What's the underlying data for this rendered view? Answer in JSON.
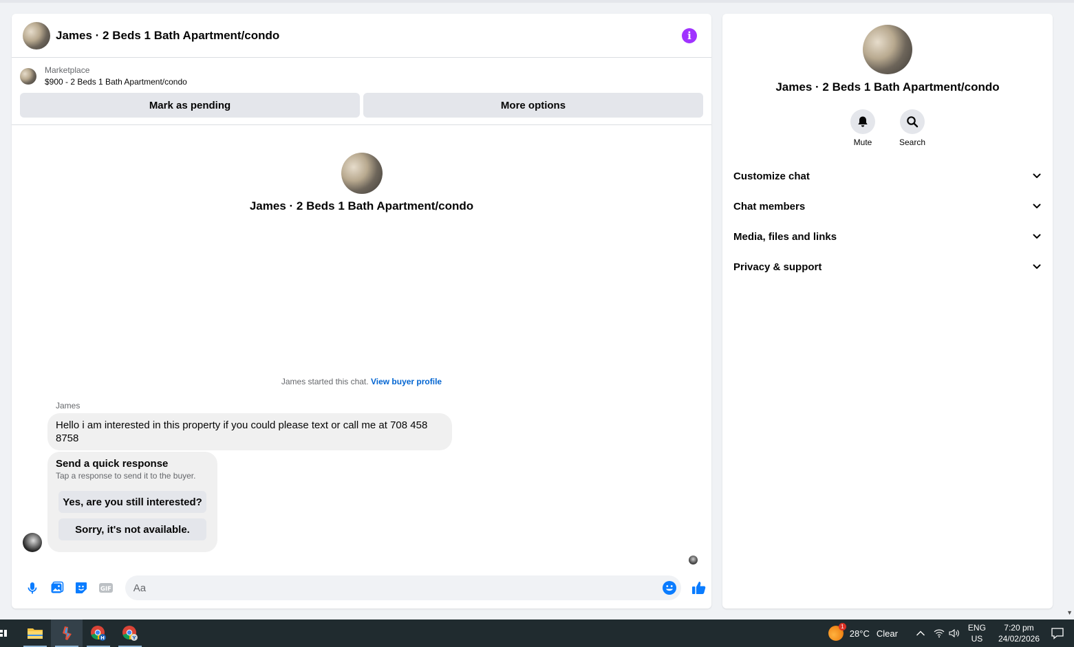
{
  "chat": {
    "title": "James · 2 Beds 1 Bath Apartment/condo",
    "listing": {
      "source": "Marketplace",
      "price_title": "$900 - 2 Beds 1 Bath Apartment/condo",
      "mark_pending": "Mark as pending",
      "more_options": "More options"
    },
    "intro_name": "James · 2 Beds 1 Bath Apartment/condo",
    "started_text": "James started this chat.",
    "view_profile": "View buyer profile",
    "sender": "James",
    "message": "Hello i am interested in this property if you could please text or call me at 708 458 8758",
    "quick": {
      "title": "Send a quick response",
      "subtitle": "Tap a response to send it to the buyer.",
      "option1": "Yes, are you still interested?",
      "option2": "Sorry, it's not available."
    },
    "composer_placeholder": "Aa"
  },
  "info": {
    "name": "James · 2 Beds 1 Bath Apartment/condo",
    "mute": "Mute",
    "search": "Search",
    "sections": [
      "Customize chat",
      "Chat members",
      "Media, files and links",
      "Privacy & support"
    ]
  },
  "taskbar": {
    "weather_temp": "28°C",
    "weather_desc": "Clear",
    "weather_badge": "1",
    "lang_top": "ENG",
    "lang_bottom": "US",
    "time": "7:20 pm",
    "date": "24/02/2026"
  },
  "colors": {
    "accent_blue": "#0064d1",
    "info_purple": "#a033ff",
    "messenger_blue": "#0a7cff"
  }
}
